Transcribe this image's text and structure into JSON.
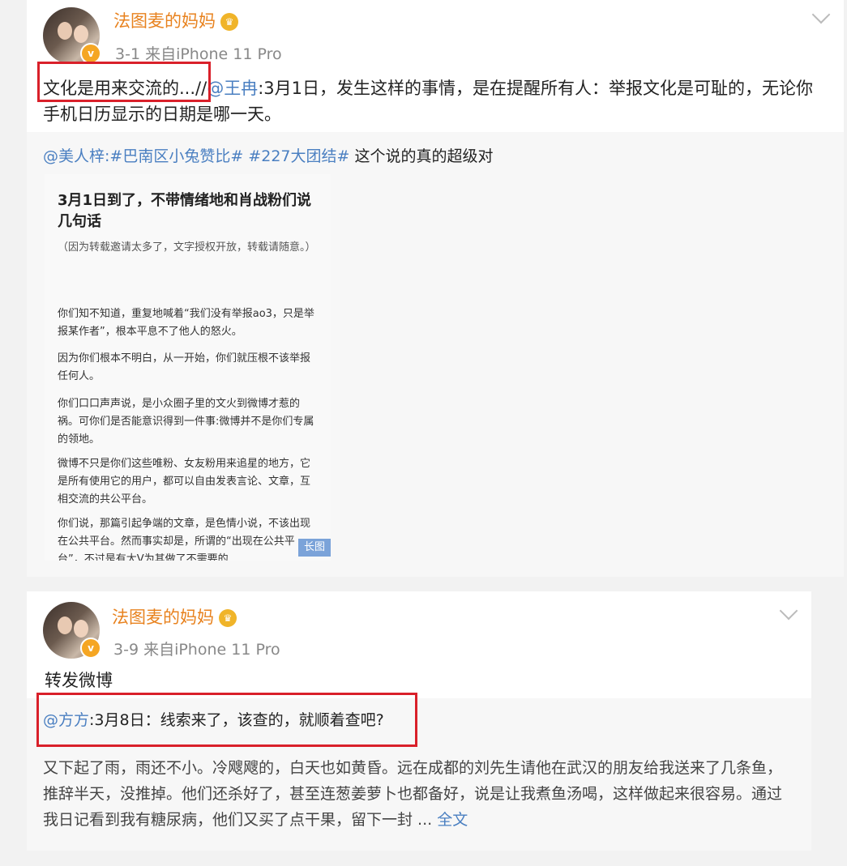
{
  "post1": {
    "author": "法图麦的妈妈",
    "meta": "3-1  来自iPhone 11 Pro",
    "text_highlight": "文化是用来交流的...",
    "text_separator": "//",
    "text_mention": "@王冉",
    "text_rest": ":3月1日，发生这样的事情，是在提醒所有人：举报文化是可耻的，无论你手机日历显示的日期是哪一天。",
    "repost_mention": "@美人梓",
    "repost_tag1": ":#巴南区小兔赞比#",
    "repost_tag2": " #227大团结#",
    "repost_text": " 这个说的真的超级对",
    "long_image": {
      "title": "3月1日到了，不带情绪地和肖战粉们说几句话",
      "paragraphs": [
        "（因为转载邀请太多了，文字授权开放，转载请随意。）",
        "你们知不知道，重复地喊着“我们没有举报ao3，只是举报某作者”，根本平息不了他人的怒火。",
        "因为你们根本不明白，从一开始，你们就压根不该举报任何人。",
        "你们口口声声说，是小众圈子里的文火到微博才惹的祸。可你们是否能意识得到一件事:微博并不是你们专属的领地。",
        "微博不只是你们这些唯粉、女友粉用来追星的地方，它是所有使用它的用户，都可以自由发表言论、文章，互相交流的共公平台。",
        "你们说，那篇引起争端的文章，是色情小说，不该出现在公共平台。然而事实却是，所谓的“出现在公共平台”，不过是有大V为其做了不需要的"
      ],
      "tag": "长图"
    }
  },
  "post2": {
    "author": "法图麦的妈妈",
    "meta": "3-9  来自iPhone 11 Pro",
    "text": "转发微博",
    "repost_mention": "@方方",
    "repost_head": ":3月8日：线索来了，该查的，就顺着查吧?",
    "repost_body": "又下起了雨，雨还不小。冷飕飕的，白天也如黄昏。远在成都的刘先生请他在武汉的朋友给我送来了几条鱼，推辞半天，没推掉。他们还杀好了，甚至连葱姜萝卜也都备好，说是让我煮鱼汤喝，这样做起来很容易。通过我日记看到我有糖尿病，他们又买了点干果，留下一封 ... ",
    "full_text_link": "全文"
  }
}
